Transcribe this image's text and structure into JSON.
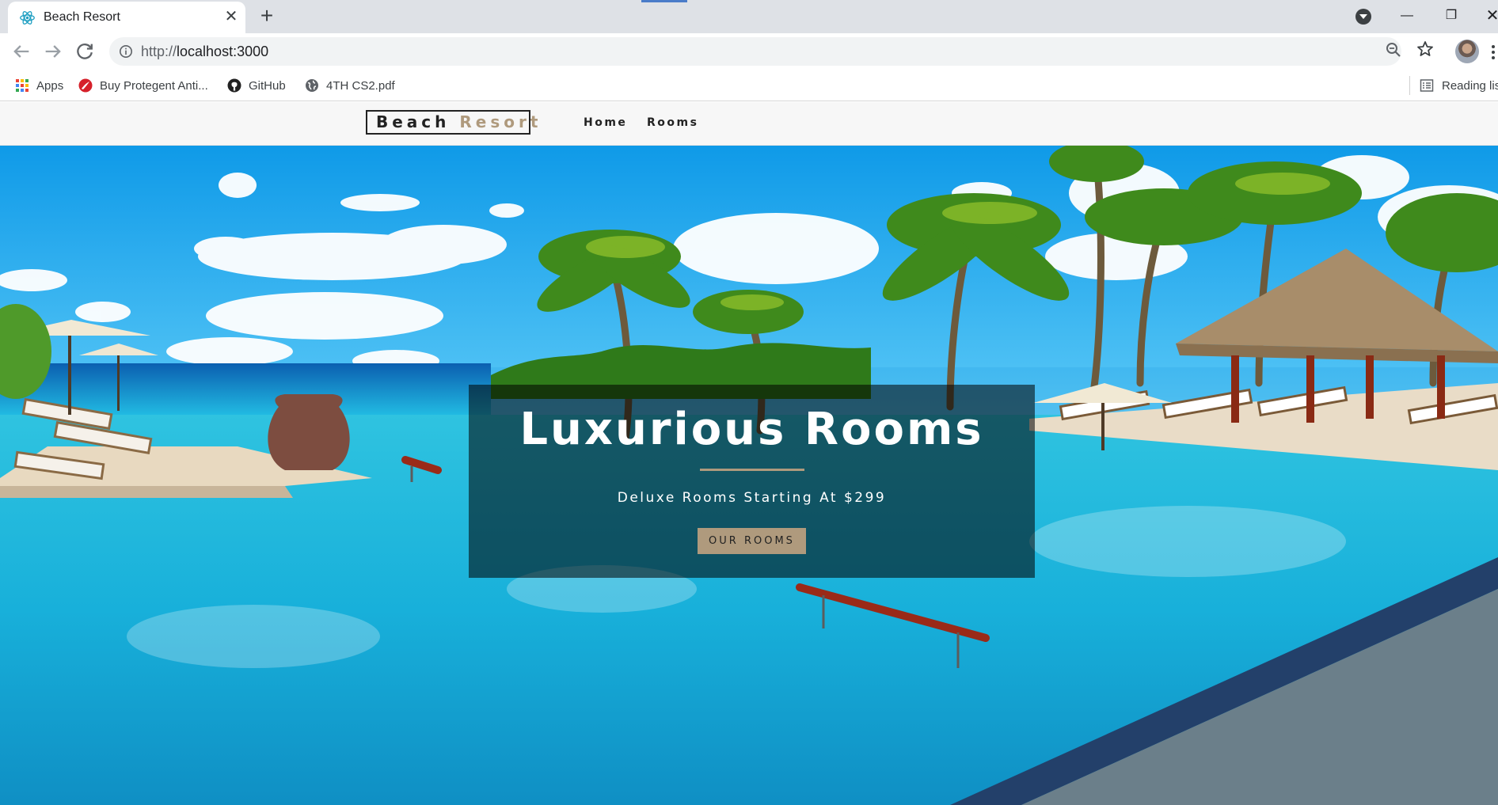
{
  "browser": {
    "tab": {
      "title": "Beach Resort",
      "close": "✕"
    },
    "new_tab": "+",
    "window_controls": {
      "minimize": "—",
      "maximize": "❐",
      "close": "✕"
    },
    "url": {
      "scheme": "http://",
      "host": "localhost:3000"
    },
    "bookmarks": [
      {
        "label": "Apps",
        "icon": "apps-grid-icon"
      },
      {
        "label": "Buy Protegent Anti...",
        "icon": "protegent-icon"
      },
      {
        "label": "GitHub",
        "icon": "github-icon"
      },
      {
        "label": "4TH CS2.pdf",
        "icon": "globe-icon"
      }
    ],
    "reading_list": "Reading lis"
  },
  "site": {
    "logo": {
      "word1": "Beach",
      "word2": "Resort"
    },
    "nav": {
      "home": "Home",
      "rooms": "Rooms"
    },
    "banner": {
      "title": "Luxurious Rooms",
      "subtitle": "Deluxe Rooms Starting At $299",
      "button": "our rooms"
    },
    "colors": {
      "accent": "#af9a7d",
      "dark": "#222222",
      "nav_bg": "#f7f7f7"
    }
  }
}
